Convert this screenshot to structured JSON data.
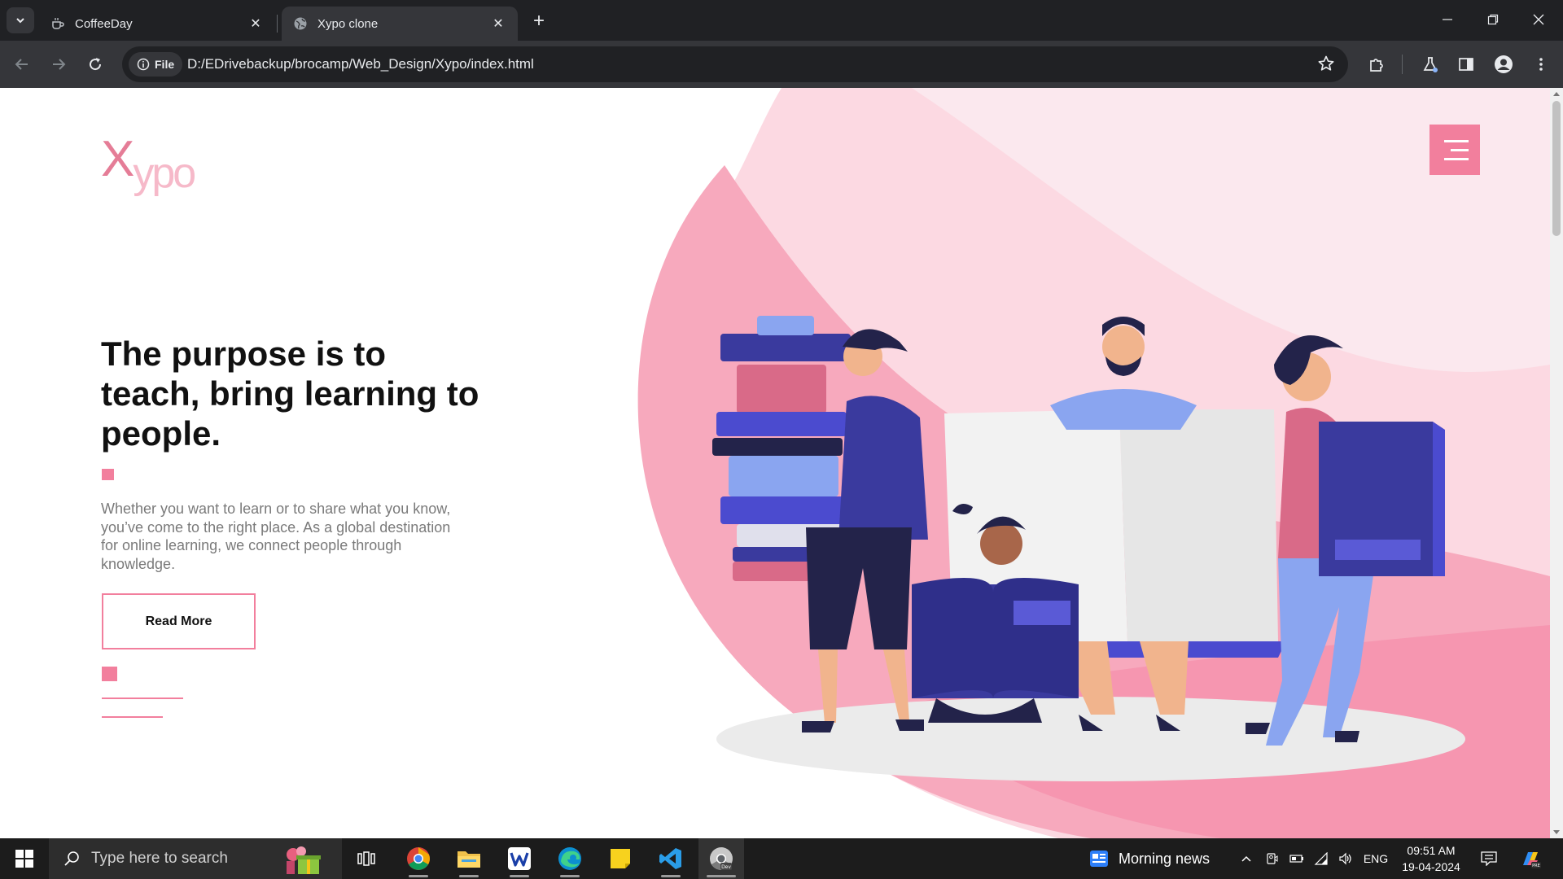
{
  "browser": {
    "tabs": [
      {
        "title": "CoffeeDay",
        "active": false,
        "favicon": "coffee-cup-icon"
      },
      {
        "title": "Xypo clone",
        "active": true,
        "favicon": "globe-icon"
      }
    ],
    "address": {
      "chip_label": "File",
      "url": "D:/EDrivebackup/brocamp/Web_Design/Xypo/index.html"
    }
  },
  "page": {
    "logo": {
      "first": "X",
      "rest": "ypo"
    },
    "headline": "The purpose is to teach, bring learning to people.",
    "paragraph": "Whether you want to learn or to share what you know, you’ve come to the right place. As a global destination for online learning, we connect people through knowledge.",
    "read_more_label": "Read More",
    "colors": {
      "accent": "#f27f9d",
      "blob_dark": "#f7a9bd",
      "blob_light": "#fcd9e2"
    }
  },
  "taskbar": {
    "search_placeholder": "Type here to search",
    "news_label": "Morning news",
    "language": "ENG",
    "time": "09:51 AM",
    "date": "19-04-2024",
    "apps": [
      "task-view-icon",
      "chrome-icon",
      "file-explorer-icon",
      "word-app-icon",
      "edge-icon",
      "sticky-notes-icon",
      "vscode-icon",
      "chrome-dev-icon"
    ]
  }
}
